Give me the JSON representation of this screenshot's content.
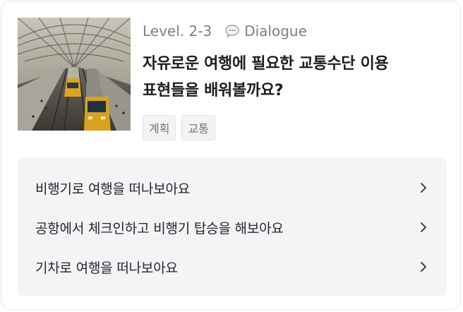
{
  "lesson": {
    "level": "Level. 2-3",
    "type_label": "Dialogue",
    "title_line1": "자유로운 여행에 필요한 교통수단 이용",
    "title_line2": "표현들을 배워볼까요?",
    "tags": [
      "계획",
      "교통"
    ],
    "thumbnail": "train-station-photo"
  },
  "items": [
    {
      "label": "비행기로 여행을 떠나보아요",
      "icon": "chevron-right-icon"
    },
    {
      "label": "공항에서 체크인하고 비행기 탑승을 해보아요",
      "icon": "chevron-right-icon"
    },
    {
      "label": "기차로 여행을 떠나보아요",
      "icon": "chevron-right-icon"
    }
  ],
  "colors": {
    "title": "#1b1d21",
    "meta": "#7b7f86",
    "list_bg": "#f3f4f6",
    "tag_bg": "#f2f3f5"
  }
}
